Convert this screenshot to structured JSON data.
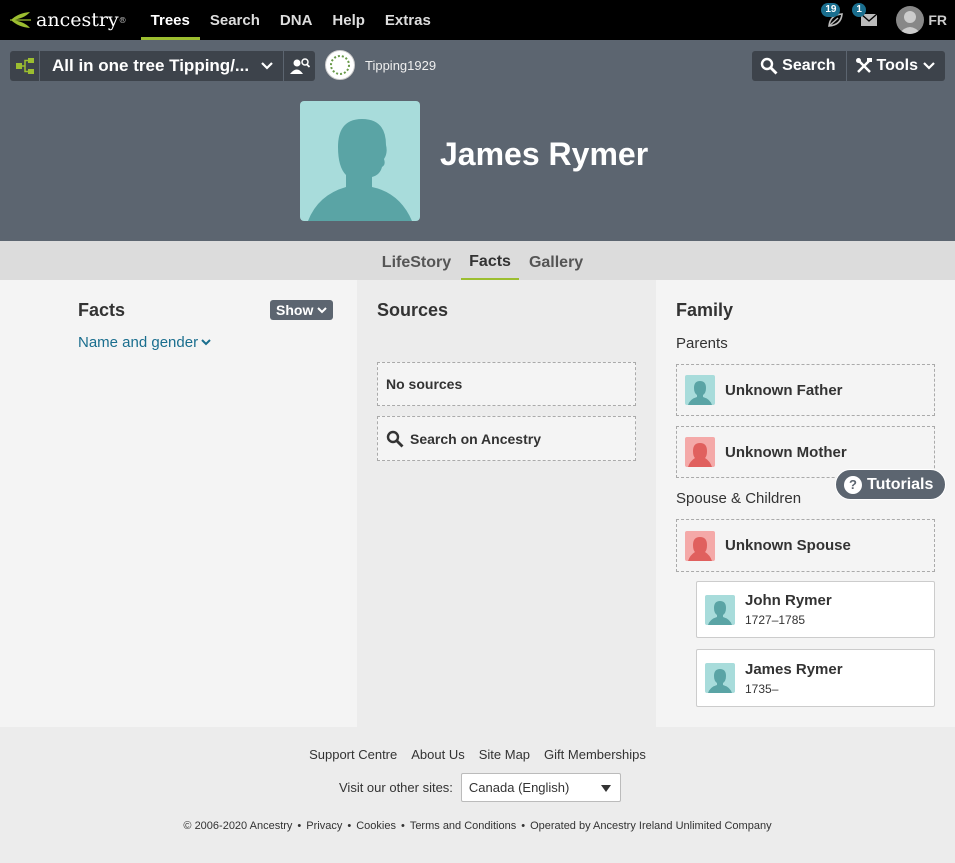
{
  "nav": {
    "logo_text": "ancestry",
    "links": [
      "Trees",
      "Search",
      "DNA",
      "Help",
      "Extras"
    ],
    "active": "Trees",
    "hints_count": "19",
    "messages_count": "1",
    "user_initials": "FR"
  },
  "treebar": {
    "tree_name": "All in one tree Tipping/...",
    "owner": "Tipping1929",
    "search_label": "Search",
    "tools_label": "Tools"
  },
  "person": {
    "name": "James Rymer"
  },
  "tabs": [
    "LifeStory",
    "Facts",
    "Gallery"
  ],
  "active_tab": "Facts",
  "facts": {
    "title": "Facts",
    "show_label": "Show",
    "name_gender_label": "Name and gender"
  },
  "sources": {
    "title": "Sources",
    "no_sources": "No sources",
    "search_label": "Search on Ancestry"
  },
  "family": {
    "title": "Family",
    "parents_label": "Parents",
    "father": "Unknown Father",
    "mother": "Unknown Mother",
    "spouse_children_label": "Spouse & Children",
    "spouse": "Unknown Spouse",
    "children": [
      {
        "name": "John Rymer",
        "dates": "1727–1785"
      },
      {
        "name": "James Rymer",
        "dates": "1735–"
      }
    ]
  },
  "tutorials_label": "Tutorials",
  "footer": {
    "links": [
      "Support Centre",
      "About Us",
      "Site Map",
      "Gift Memberships"
    ],
    "other_sites_label": "Visit our other sites:",
    "site_value": "Canada (English)",
    "legal": [
      "© 2006-2020 Ancestry",
      "Privacy",
      "Cookies",
      "Terms and Conditions",
      "Operated by Ancestry Ireland Unlimited Company"
    ]
  },
  "colors": {
    "accent_green": "#9cbe30",
    "header_gray": "#5c6570",
    "link_blue": "#1a6e8e",
    "male_tile": "#a8dcdb",
    "female_tile": "#f4a9a8"
  }
}
